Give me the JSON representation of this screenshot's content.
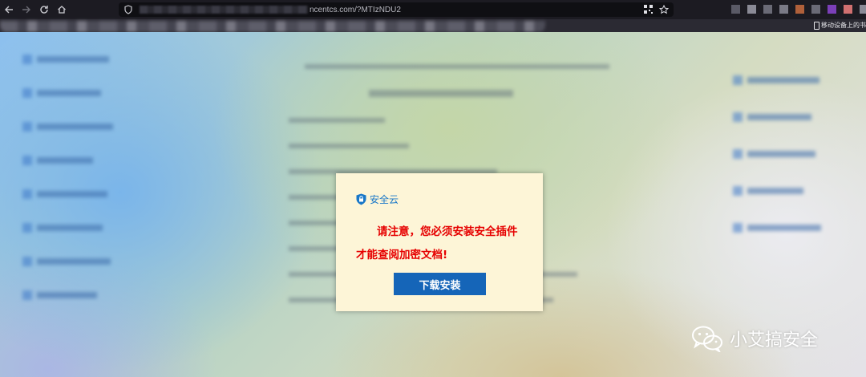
{
  "browser": {
    "url_visible": "ncentcs.com/?MTIzNDU2",
    "bookmark_right": "移动设备上的书"
  },
  "dialog": {
    "brand_name": "安全云",
    "message_line1": "请注意，您必须安装安全插件",
    "message_line2": "才能查阅加密文档!",
    "button_label": "下载安装",
    "colors": {
      "background": "#fdf5d7",
      "message": "#e60000",
      "brand": "#1877c8",
      "button": "#1565b8"
    }
  },
  "watermark": {
    "text": "小艾搞安全",
    "icon": "wechat-icon"
  }
}
